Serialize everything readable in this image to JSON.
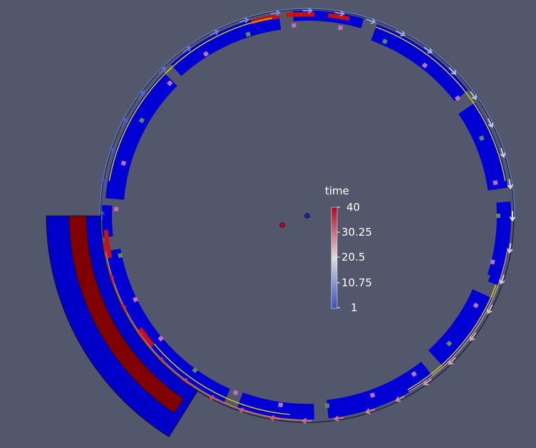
{
  "scene": {
    "background_color": "#52576b",
    "colormap": {
      "low": "#3b4cc0",
      "mid": "#dddddd",
      "high": "#b40426"
    }
  },
  "legend": {
    "title": "time",
    "labels": [
      "40",
      "30.25",
      "20.5",
      "10.75",
      "1"
    ]
  }
}
